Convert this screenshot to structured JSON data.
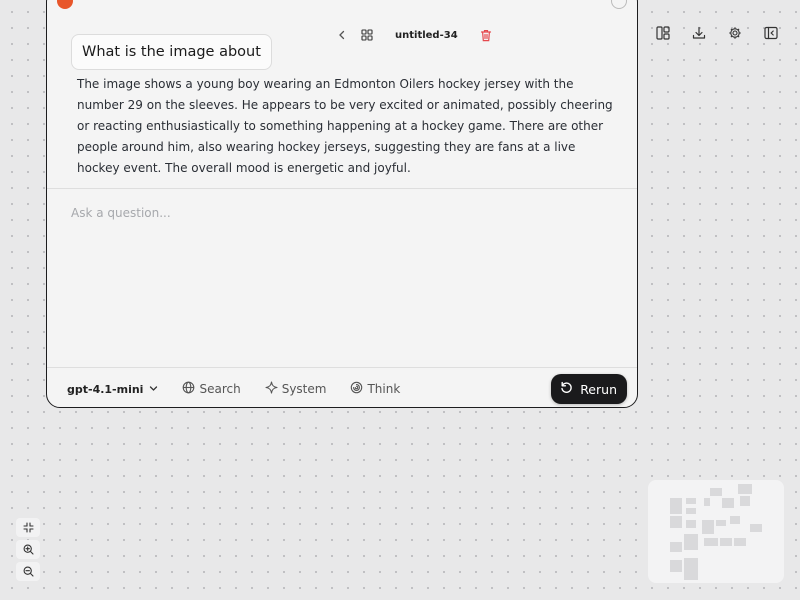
{
  "node": {
    "title": "untitled-34",
    "icons": [
      "chevron-left-icon",
      "grid-icon",
      "trash-icon"
    ],
    "colors": {
      "trash": "#e5484d",
      "border": "#1d1d1f",
      "rerun_bg": "#1a1a1c"
    }
  },
  "chat": {
    "question": "What is the image about",
    "answer": "The image shows a young boy wearing an Edmonton Oilers hockey jersey with the number 29 on the sleeves. He appears to be very excited or animated, possibly cheering or reacting enthusiastically to something happening at a hockey game. There are other people around him, also wearing hockey jerseys, suggesting they are fans at a live hockey event. The overall mood is energetic and joyful.",
    "input_placeholder": "Ask a question..."
  },
  "footer": {
    "model": "gpt-4.1-mini",
    "search_label": "Search",
    "system_label": "System",
    "think_label": "Think",
    "rerun_label": "Rerun"
  },
  "top_right_toolbar": [
    "layout-icon",
    "download-icon",
    "settings-icon",
    "sidebar-toggle-icon"
  ],
  "zoom_controls": [
    "fit-view-icon",
    "zoom-in-icon",
    "zoom-out-icon"
  ]
}
